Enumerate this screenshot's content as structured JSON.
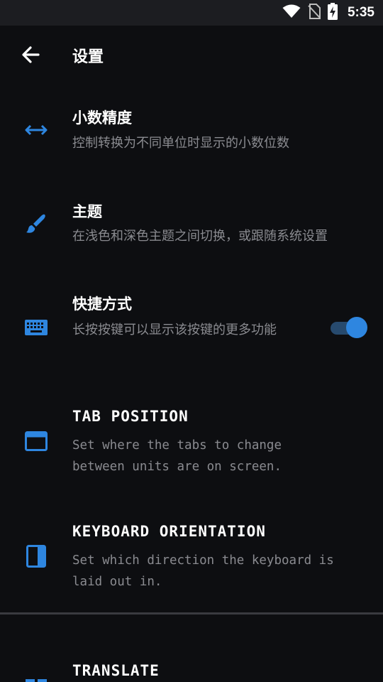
{
  "status_bar": {
    "time": "5:35"
  },
  "app_bar": {
    "title": "设置"
  },
  "settings": [
    {
      "title": "小数精度",
      "description": "控制转换为不同单位时显示的小数位数",
      "icon": "horizontal-arrows-icon"
    },
    {
      "title": "主题",
      "description": "在浅色和深色主题之间切换，或跟随系统设置",
      "icon": "brush-icon"
    },
    {
      "title": "快捷方式",
      "description": "长按按键可以显示该按键的更多功能",
      "icon": "keyboard-icon",
      "toggle_on": true
    },
    {
      "title": "TAB POSITION",
      "description": "Set where the tabs to change between units are on screen.",
      "icon": "tab-window-icon"
    },
    {
      "title": "KEYBOARD ORIENTATION",
      "description": "Set which direction the keyboard is laid out in.",
      "icon": "panel-side-icon"
    },
    {
      "title": "TRANSLATE",
      "icon": "grid-icon"
    }
  ],
  "colors": {
    "accent": "#2e86e0",
    "background": "#0d0e11",
    "secondary_text": "#8a8b90"
  }
}
